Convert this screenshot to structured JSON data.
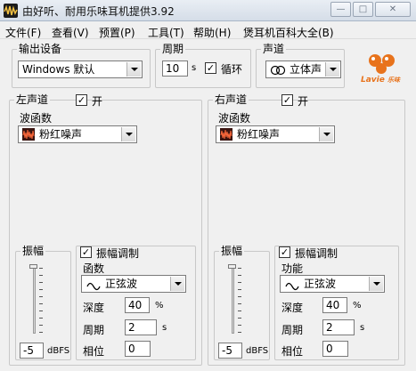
{
  "window": {
    "title": "由好听、耐用乐味耳机提供3.92"
  },
  "menu": [
    {
      "label": "文件(F)"
    },
    {
      "label": "查看(V)"
    },
    {
      "label": "预置(P)"
    },
    {
      "label": "工具(T)"
    },
    {
      "label": "帮助(H)"
    },
    {
      "label": "煲耳机百科大全(B)"
    }
  ],
  "output_device": {
    "legend": "输出设备",
    "value": "Windows 默认"
  },
  "period": {
    "legend": "周期",
    "value": "10",
    "unit": "s",
    "loop_label": "循环",
    "loop_checked": "✓"
  },
  "channel": {
    "legend": "声道",
    "value": "立体声"
  },
  "brand": {
    "logo_text": "Lavie",
    "logo_sub": "乐味"
  },
  "left": {
    "legend": "左声道",
    "on_label": "开",
    "on_checked": "✓",
    "wave_label": "波函数",
    "wave_value": "粉红噪声",
    "amp_legend": "振幅",
    "amp_value": "-5",
    "amp_unit": "dBFS",
    "mod_label": "振幅调制",
    "mod_checked": "✓",
    "func_label": "函数",
    "func_value": "正弦波",
    "depth_label": "深度",
    "depth_value": "40",
    "depth_unit": "%",
    "cycle_label": "周期",
    "cycle_value": "2",
    "cycle_unit": "s",
    "phase_label": "相位",
    "phase_value": "0"
  },
  "right": {
    "legend": "右声道",
    "on_label": "开",
    "on_checked": "✓",
    "wave_label": "波函数",
    "wave_value": "粉红噪声",
    "amp_legend": "振幅",
    "amp_value": "-5",
    "amp_unit": "dBFS",
    "mod_label": "振幅调制",
    "mod_checked": "✓",
    "func_label": "功能",
    "func_value": "正弦波",
    "depth_label": "深度",
    "depth_value": "40",
    "depth_unit": "%",
    "cycle_label": "周期",
    "cycle_value": "2",
    "cycle_unit": "s",
    "phase_label": "相位",
    "phase_value": "0"
  },
  "icons": {
    "app": "app-icon",
    "stereo": "stereo-icon",
    "noise": "noise-waveform-icon",
    "sine": "sine-wave-icon"
  },
  "colors": {
    "accent_orange": "#e8731c",
    "noise_icon": "#c0392b"
  }
}
